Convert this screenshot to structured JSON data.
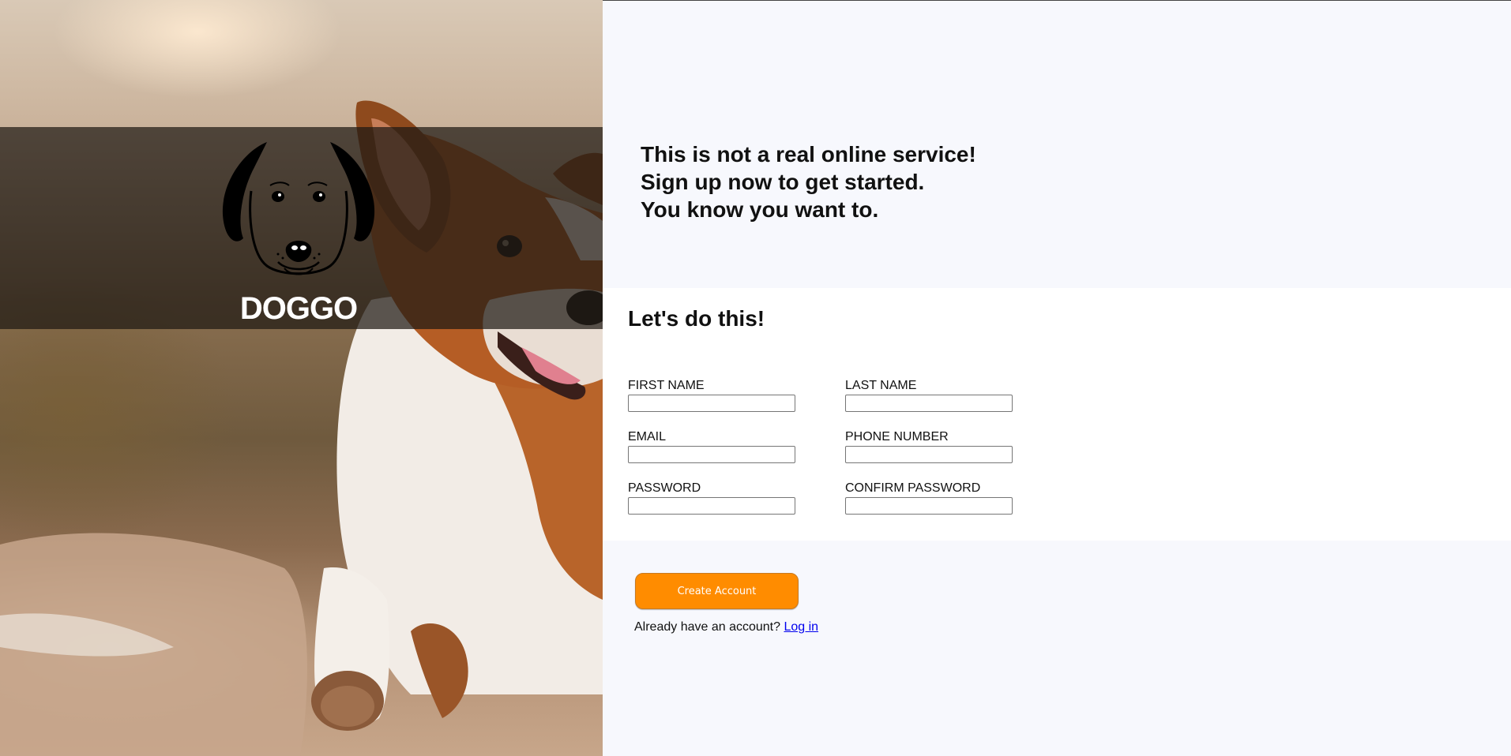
{
  "hero": {
    "logo_text": "DOGGO"
  },
  "headline": {
    "line1": "This is not a real online service!",
    "line2": "Sign up now to get started.",
    "line3": "You know you want to."
  },
  "form": {
    "title": "Let's do this!",
    "fields": {
      "first_name": {
        "label": "FIRST NAME",
        "value": ""
      },
      "last_name": {
        "label": "LAST NAME",
        "value": ""
      },
      "email": {
        "label": "EMAIL",
        "value": ""
      },
      "phone": {
        "label": "PHONE NUMBER",
        "value": ""
      },
      "password": {
        "label": "PASSWORD",
        "value": ""
      },
      "confirm_password": {
        "label": "CONFIRM PASSWORD",
        "value": ""
      }
    }
  },
  "actions": {
    "create_label": "Create Account",
    "login_prompt": "Already have an account?",
    "login_link": "Log in"
  },
  "colors": {
    "accent": "#ff8c00",
    "page_bg": "#f7f8fd",
    "form_bg": "#ffffff"
  }
}
